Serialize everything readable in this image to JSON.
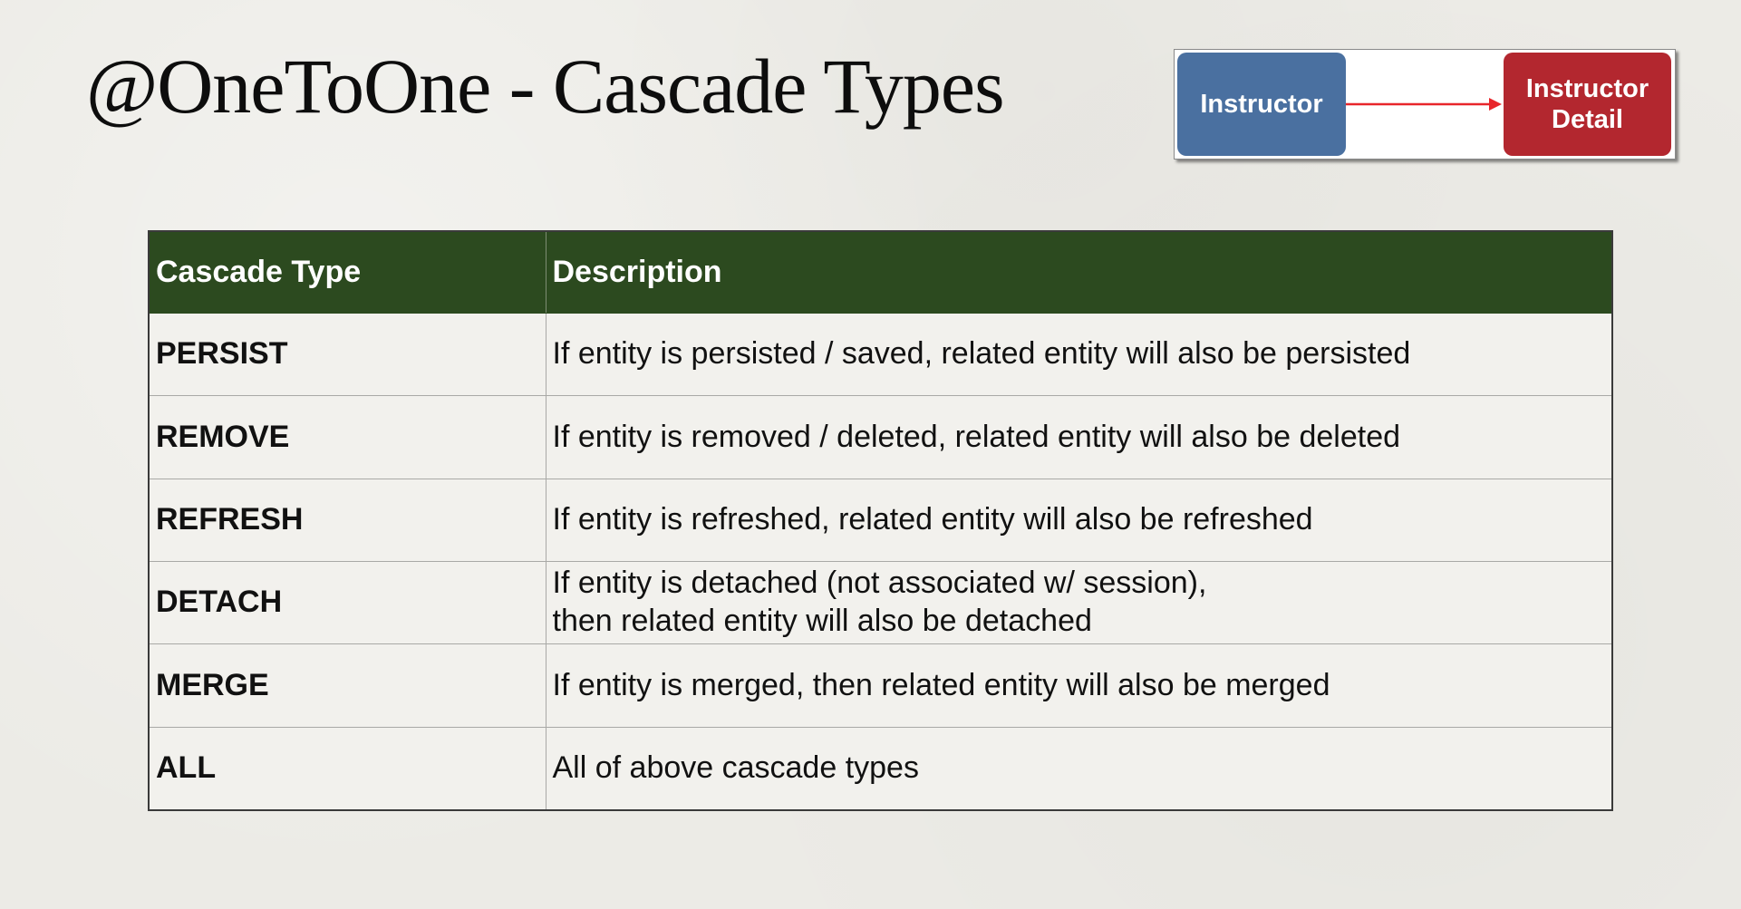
{
  "slide": {
    "title": "@OneToOne - Cascade Types"
  },
  "diagram": {
    "source_label": "Instructor",
    "target_label_line1": "Instructor",
    "target_label_line2": "Detail",
    "colors": {
      "source": "#4a70a0",
      "target": "#b3272f",
      "arrow": "#e8262b"
    }
  },
  "table": {
    "headers": [
      "Cascade Type",
      "Description"
    ],
    "header_color": "#2c4a1f",
    "rows": [
      {
        "type": "PERSIST",
        "description": [
          "If entity is persisted / saved, related entity will also be persisted"
        ]
      },
      {
        "type": "REMOVE",
        "description": [
          "If entity is removed / deleted, related entity will also be deleted"
        ]
      },
      {
        "type": "REFRESH",
        "description": [
          "If entity is refreshed, related entity will also be refreshed"
        ]
      },
      {
        "type": "DETACH",
        "description": [
          "If entity is detached (not associated w/ session),",
          "then related entity will also be detached"
        ]
      },
      {
        "type": "MERGE",
        "description": [
          "If entity is merged, then related entity will also be merged"
        ]
      },
      {
        "type": "ALL",
        "description": [
          "All of above cascade types"
        ]
      }
    ]
  }
}
